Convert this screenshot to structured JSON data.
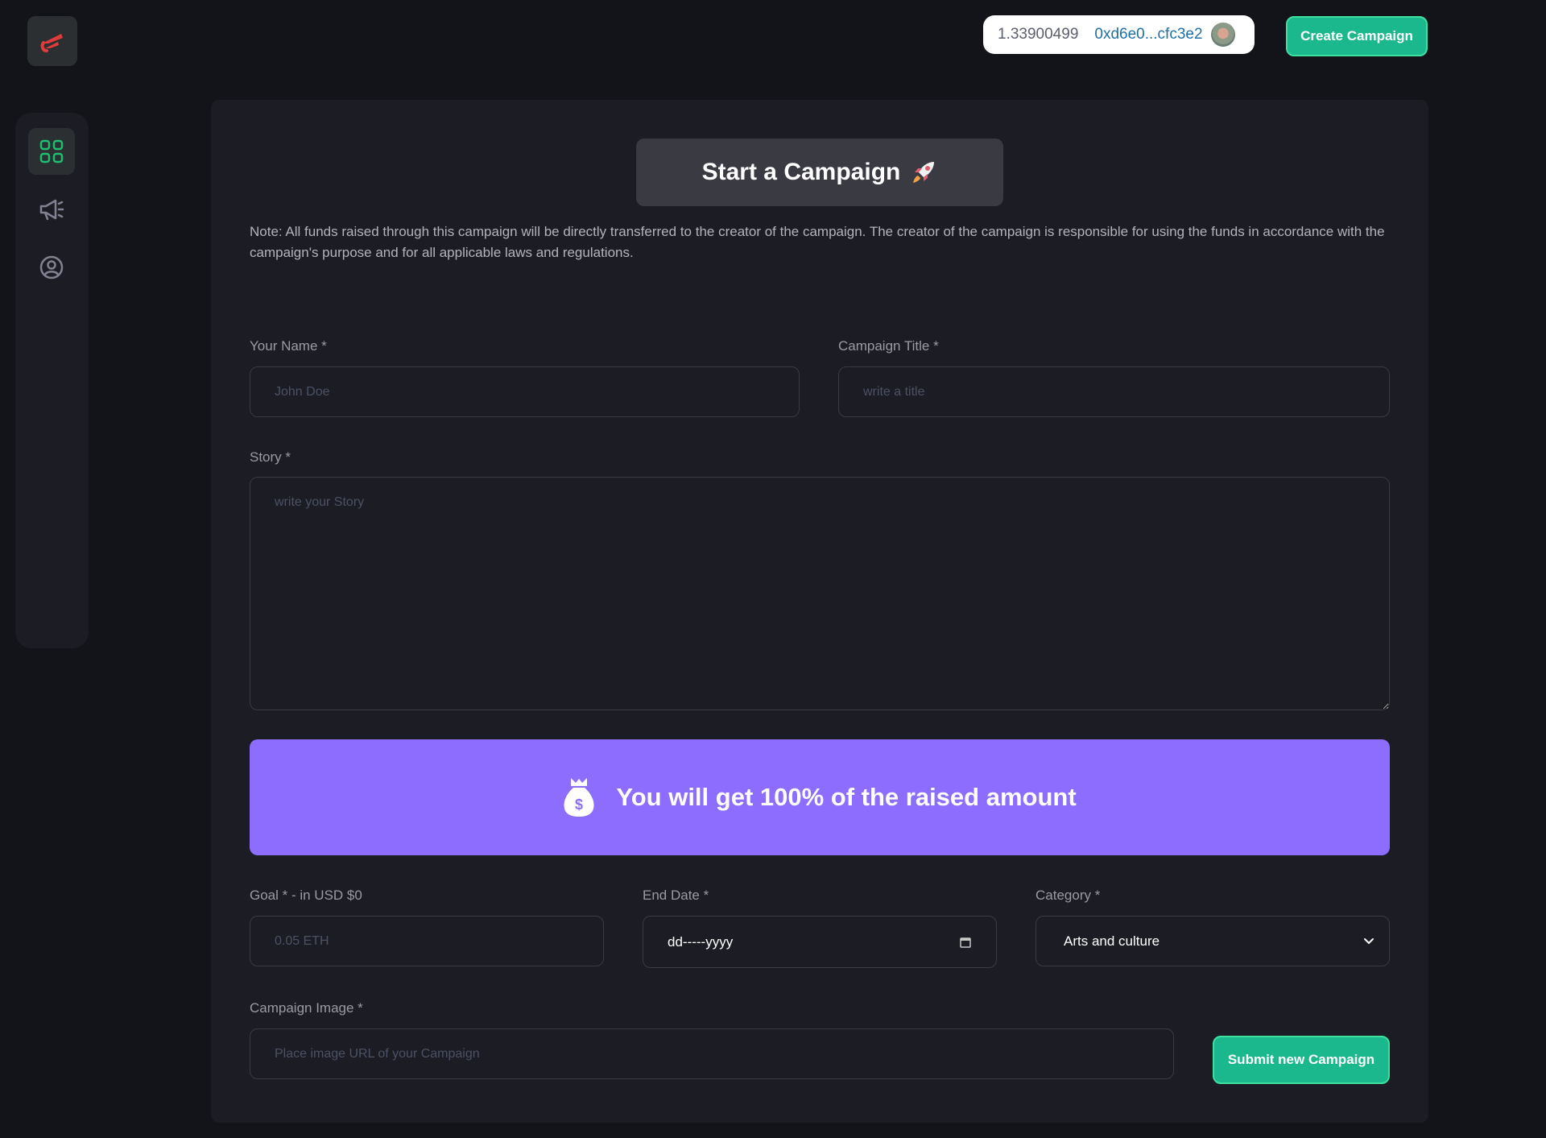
{
  "header": {
    "wallet_balance": "1.33900499",
    "wallet_address": "0xd6e0...cfc3e2",
    "create_button": "Create Campaign"
  },
  "sidebar": {
    "items": [
      {
        "icon": "dashboard-icon",
        "active": true
      },
      {
        "icon": "megaphone-icon",
        "active": false
      },
      {
        "icon": "profile-icon",
        "active": false
      }
    ]
  },
  "form": {
    "title": "Start a Campaign",
    "note": "Note: All funds raised through this campaign will be directly transferred to the creator of the campaign. The creator of the campaign is responsible for using the funds in accordance with the campaign's purpose and for all applicable laws and regulations.",
    "name_label": "Your Name *",
    "name_placeholder": "John Doe",
    "campaign_title_label": "Campaign Title *",
    "campaign_title_placeholder": "write a title",
    "story_label": "Story *",
    "story_placeholder": "write your Story",
    "banner_text": "You will get 100% of the raised amount",
    "goal_label": "Goal * - in USD $0",
    "goal_placeholder": "0.05 ETH",
    "end_date_label": "End Date *",
    "end_date_value": "dd-----yyyy",
    "category_label": "Category *",
    "category_value": "Arts and culture",
    "image_label": "Campaign Image *",
    "image_placeholder": "Place image URL of your Campaign",
    "submit_button": "Submit new Campaign"
  },
  "colors": {
    "background": "#13131a",
    "panel": "#1c1c24",
    "accent_green": "#1bb88e",
    "banner_purple": "#8c6dfd",
    "active_icon_green": "#1dc071"
  }
}
